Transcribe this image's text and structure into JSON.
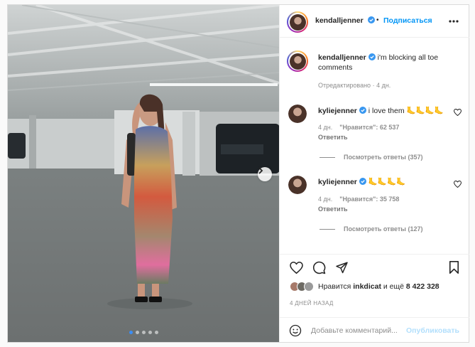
{
  "post": {
    "author": "kendalljenner",
    "separator": "•",
    "follow_label": "Подписаться",
    "more_label": "•••",
    "caption": {
      "username": "kendalljenner",
      "text": "i'm blocking all toe comments",
      "edited": "Отредактировано",
      "age": "4 дн."
    },
    "comments": [
      {
        "username": "kyliejenner",
        "text": "i love them 🦶🦶🦶🦶",
        "age": "4 дн.",
        "likes": "\"Нравится\": 62 537",
        "reply_label": "Ответить",
        "view_replies": "Посмотреть ответы (357)"
      },
      {
        "username": "kyliejenner",
        "text": "🦶🦶🦶🦶",
        "age": "4 дн.",
        "likes": "\"Нравится\": 35 758",
        "reply_label": "Ответить",
        "view_replies": "Посмотреть ответы (127)"
      }
    ],
    "likes_summary": {
      "prefix": "Нравится",
      "user": "inkdicat",
      "and": "и ещё",
      "count": "8 422 328"
    },
    "posted_ago": "4 ДНЕЙ НАЗАД",
    "add_comment_placeholder": "Добавьте комментарий...",
    "publish_label": "Опубликовать"
  },
  "carousel": {
    "total": 5,
    "active": 1
  },
  "colors": {
    "accent": "#0095f6",
    "verified": "#3897f0",
    "muted": "#8e8e8e"
  },
  "icons": [
    "heart-icon",
    "comment-icon",
    "share-icon",
    "bookmark-icon",
    "emoji-icon",
    "chevron-right-icon",
    "verified-icon",
    "more-icon"
  ]
}
